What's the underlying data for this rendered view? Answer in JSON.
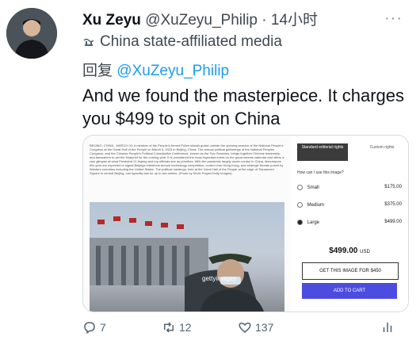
{
  "tweet": {
    "author_name": "Xu Zeyu",
    "handle": "@XuZeyu_Philip",
    "separator": "·",
    "time": "14小时",
    "more_label": "···",
    "affiliation_label": "China state-affiliated media",
    "reply_prefix": "回复",
    "reply_handle": "@XuZeyu_Philip",
    "text": "And we found the masterpiece. It charges you $499 to spit on China"
  },
  "media": {
    "caption": "BEIJING, CHINA - MARCH 03: A member of the People's Armed Police stands guard outside the opening session of the National People's Congress at the Great Hall of the People on March 5, 2023 in Beijing, China. The annual political gatherings of the National Peoples Congress, and the Chinese People's Political Consultative Conference, known as the Two Sessions, brings together Chinese leadership and lawmakers to set the blueprint for the coming year. It is considered the most important event on the governments calendar and offers a rare glimpse at what President Xi Jinping and top officials see as priorities. With the pandemic largely under control in China, discussions this year are expected to signal Beijings intentions around technology competition, control over Hong Kong, and strategic threats posed by Western countries including the United States. The political meetings, held at the Great Hall of the People at the edge of Tiananmen Square in central Beijing, can typically last for up to two weeks. (Photo by Kevin Frayer/Getty Images)",
    "watermark": "gettyimages",
    "tab_standard": "Standard editorial rights",
    "tab_custom": "Custom rights",
    "license_question": "How can I use this image?",
    "options": [
      {
        "label": "Small",
        "price": "$175.00"
      },
      {
        "label": "Medium",
        "price": "$375.00"
      },
      {
        "label": "Large",
        "price": "$499.00"
      }
    ],
    "total_price": "$499.00",
    "currency": "USD",
    "btn_get": "GET THIS IMAGE FOR $450",
    "btn_cart": "ADD TO CART"
  },
  "actions": {
    "replies": "7",
    "retweets": "12",
    "likes": "137"
  }
}
